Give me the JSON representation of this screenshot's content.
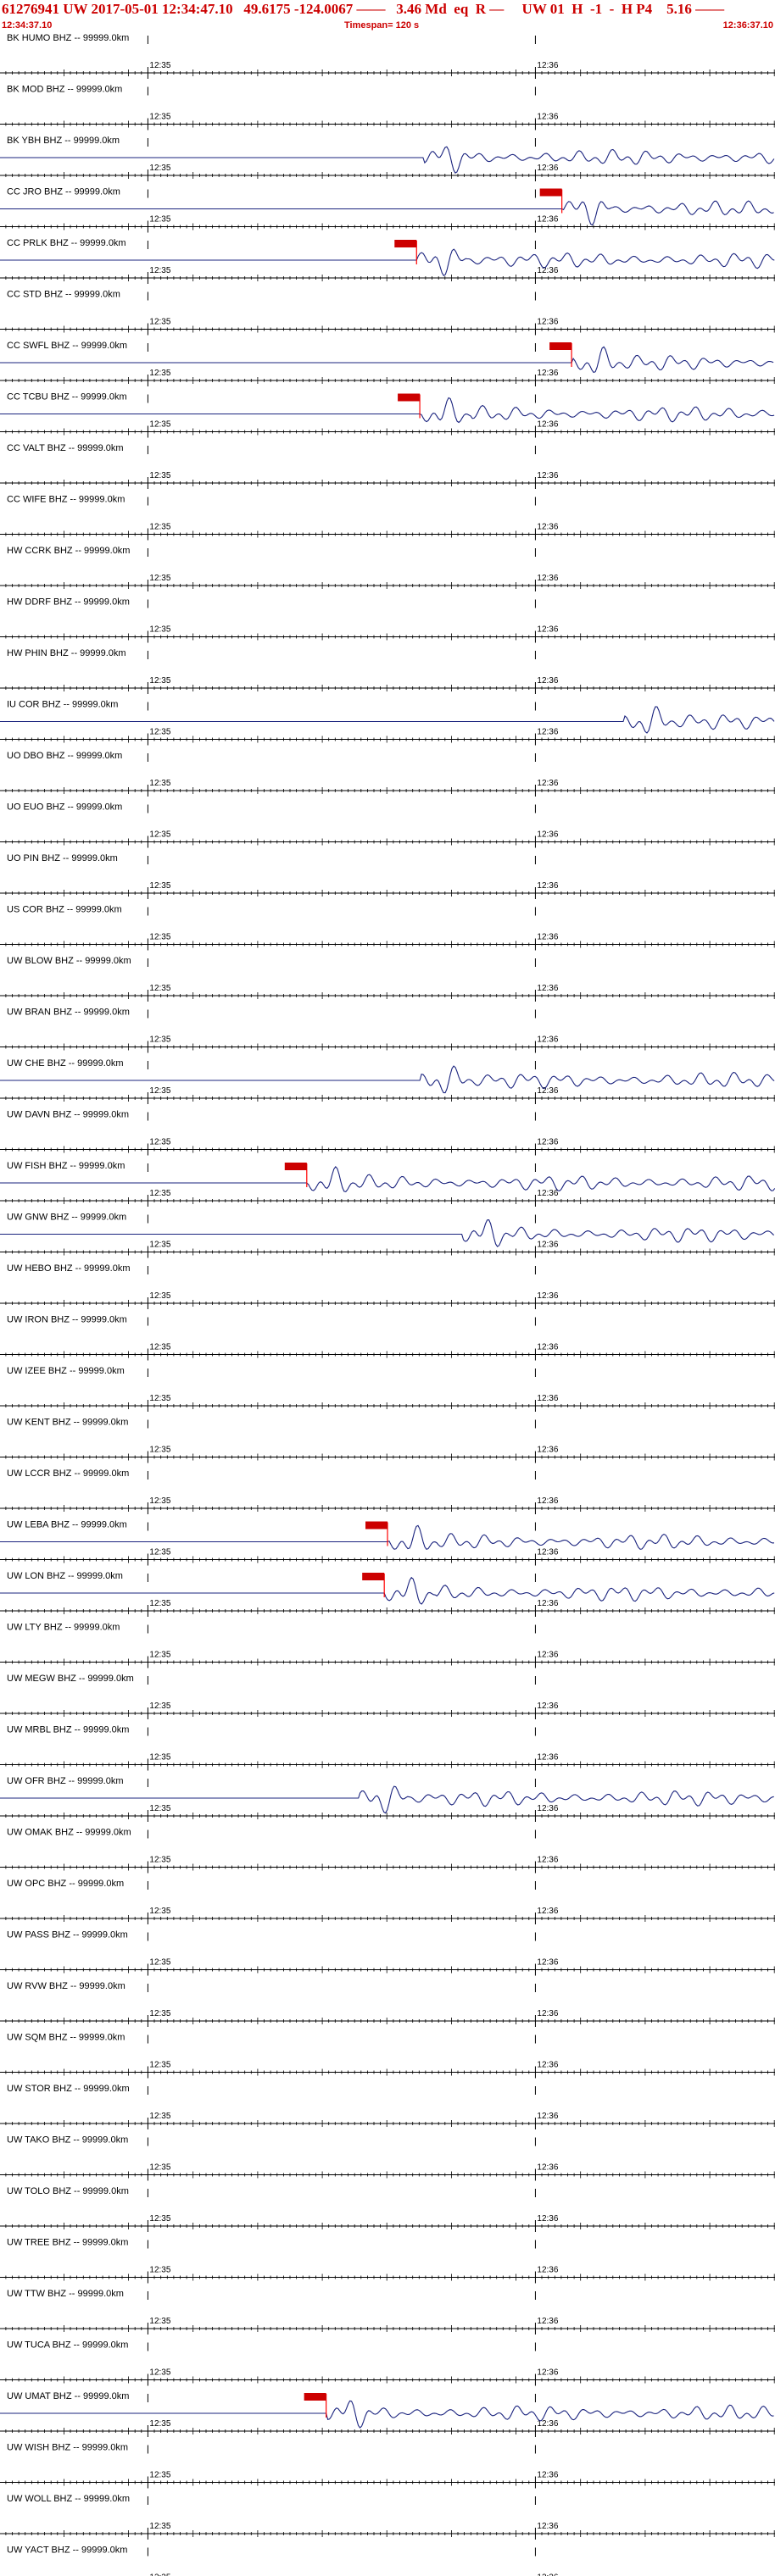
{
  "header": {
    "title": "61276941 UW 2017-05-01 12:34:47.10   49.6175 -124.0067 ——   3.46 Md  eq  R —     UW 01  H  -1  -  H P4    5.16 ——",
    "start_time": "12:34:37.10",
    "timespan": "Timespan= 120 s",
    "end_time": "12:36:37.10"
  },
  "colors": {
    "header": "#cc0000",
    "axis": "#000000",
    "trace": "#1a237e",
    "pick": "#ff0000",
    "pick_fill": "#cc0000"
  },
  "chart_data": {
    "type": "seismogram",
    "time_start": "12:34:37.10",
    "time_span_s": 120,
    "tick_labels": [
      "12:35",
      "12:36"
    ],
    "channels": [
      {
        "label": "BK HUMO BHZ -- 99999.0km",
        "arrival_s": null,
        "pick": false
      },
      {
        "label": "BK MOD BHZ -- 99999.0km",
        "arrival_s": null,
        "pick": false
      },
      {
        "label": "BK YBH BHZ -- 99999.0km",
        "arrival_s": 65.5,
        "pick": false
      },
      {
        "label": "CC JRO BHZ -- 99999.0km",
        "arrival_s": 87.0,
        "pick": true
      },
      {
        "label": "CC PRLK BHZ -- 99999.0km",
        "arrival_s": 64.5,
        "pick": true
      },
      {
        "label": "CC STD BHZ -- 99999.0km",
        "arrival_s": null,
        "pick": false
      },
      {
        "label": "CC SWFL BHZ -- 99999.0km",
        "arrival_s": 88.5,
        "pick": true
      },
      {
        "label": "CC TCBU BHZ -- 99999.0km",
        "arrival_s": 65.0,
        "pick": true
      },
      {
        "label": "CC VALT BHZ -- 99999.0km",
        "arrival_s": null,
        "pick": false
      },
      {
        "label": "CC WIFE BHZ -- 99999.0km",
        "arrival_s": null,
        "pick": false
      },
      {
        "label": "HW CCRK BHZ -- 99999.0km",
        "arrival_s": null,
        "pick": false
      },
      {
        "label": "HW DDRF BHZ -- 99999.0km",
        "arrival_s": null,
        "pick": false
      },
      {
        "label": "HW PHIN BHZ -- 99999.0km",
        "arrival_s": null,
        "pick": false
      },
      {
        "label": "IU COR BHZ -- 99999.0km",
        "arrival_s": 96.5,
        "pick": false
      },
      {
        "label": "UO DBO BHZ -- 99999.0km",
        "arrival_s": null,
        "pick": false
      },
      {
        "label": "UO EUO BHZ -- 99999.0km",
        "arrival_s": null,
        "pick": false
      },
      {
        "label": "UO PIN BHZ -- 99999.0km",
        "arrival_s": null,
        "pick": false
      },
      {
        "label": "US COR BHZ -- 99999.0km",
        "arrival_s": null,
        "pick": false
      },
      {
        "label": "UW BLOW BHZ -- 99999.0km",
        "arrival_s": null,
        "pick": false
      },
      {
        "label": "UW BRAN BHZ -- 99999.0km",
        "arrival_s": null,
        "pick": false
      },
      {
        "label": "UW CHE BHZ -- 99999.0km",
        "arrival_s": 65.0,
        "pick": false
      },
      {
        "label": "UW DAVN BHZ -- 99999.0km",
        "arrival_s": null,
        "pick": false
      },
      {
        "label": "UW FISH BHZ -- 99999.0km",
        "arrival_s": 47.5,
        "pick": true
      },
      {
        "label": "UW GNW BHZ -- 99999.0km",
        "arrival_s": 71.5,
        "pick": false
      },
      {
        "label": "UW HEBO BHZ -- 99999.0km",
        "arrival_s": null,
        "pick": false
      },
      {
        "label": "UW IRON BHZ -- 99999.0km",
        "arrival_s": null,
        "pick": false
      },
      {
        "label": "UW IZEE BHZ -- 99999.0km",
        "arrival_s": null,
        "pick": false
      },
      {
        "label": "UW KENT BHZ -- 99999.0km",
        "arrival_s": null,
        "pick": false
      },
      {
        "label": "UW LCCR BHZ -- 99999.0km",
        "arrival_s": null,
        "pick": false
      },
      {
        "label": "UW LEBA BHZ -- 99999.0km",
        "arrival_s": 60.0,
        "pick": true
      },
      {
        "label": "UW LON BHZ -- 99999.0km",
        "arrival_s": 59.5,
        "pick": true
      },
      {
        "label": "UW LTY BHZ -- 99999.0km",
        "arrival_s": null,
        "pick": false
      },
      {
        "label": "UW MEGW BHZ -- 99999.0km",
        "arrival_s": null,
        "pick": false
      },
      {
        "label": "UW MRBL BHZ -- 99999.0km",
        "arrival_s": null,
        "pick": false
      },
      {
        "label": "UW OFR BHZ -- 99999.0km",
        "arrival_s": 55.5,
        "pick": false
      },
      {
        "label": "UW OMAK BHZ -- 99999.0km",
        "arrival_s": null,
        "pick": false
      },
      {
        "label": "UW OPC BHZ -- 99999.0km",
        "arrival_s": null,
        "pick": false
      },
      {
        "label": "UW PASS BHZ -- 99999.0km",
        "arrival_s": null,
        "pick": false
      },
      {
        "label": "UW RVW BHZ -- 99999.0km",
        "arrival_s": null,
        "pick": false
      },
      {
        "label": "UW SQM BHZ -- 99999.0km",
        "arrival_s": null,
        "pick": false
      },
      {
        "label": "UW STOR BHZ -- 99999.0km",
        "arrival_s": null,
        "pick": false
      },
      {
        "label": "UW TAKO BHZ -- 99999.0km",
        "arrival_s": null,
        "pick": false
      },
      {
        "label": "UW TOLO BHZ -- 99999.0km",
        "arrival_s": null,
        "pick": false
      },
      {
        "label": "UW TREE BHZ -- 99999.0km",
        "arrival_s": null,
        "pick": false
      },
      {
        "label": "UW TTW BHZ -- 99999.0km",
        "arrival_s": null,
        "pick": false
      },
      {
        "label": "UW TUCA BHZ -- 99999.0km",
        "arrival_s": null,
        "pick": false
      },
      {
        "label": "UW UMAT BHZ -- 99999.0km",
        "arrival_s": 50.5,
        "pick": true
      },
      {
        "label": "UW WISH BHZ -- 99999.0km",
        "arrival_s": null,
        "pick": false
      },
      {
        "label": "UW WOLL BHZ -- 99999.0km",
        "arrival_s": null,
        "pick": false
      },
      {
        "label": "UW YACT BHZ -- 99999.0km",
        "arrival_s": null,
        "pick": false
      }
    ]
  }
}
